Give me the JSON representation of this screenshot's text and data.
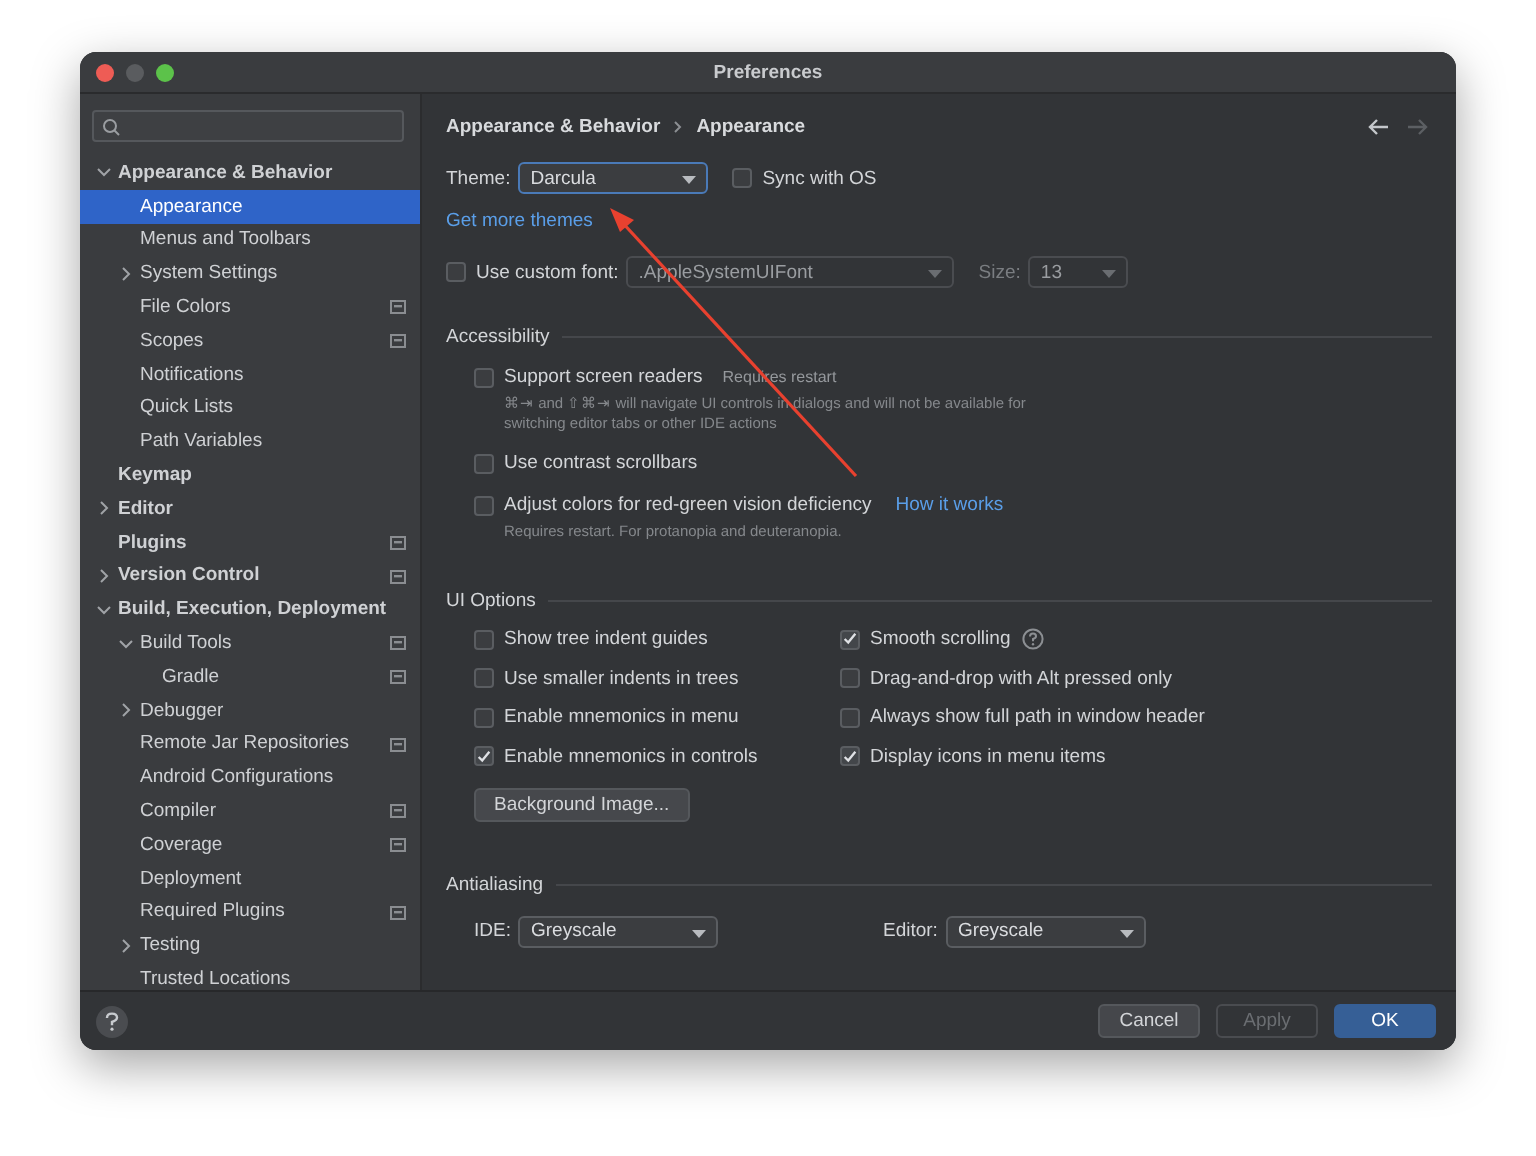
{
  "window": {
    "title": "Preferences"
  },
  "sidebar": {
    "items": [
      {
        "label": "Appearance & Behavior",
        "expanded": true,
        "selected": false,
        "children": [
          {
            "label": "Appearance",
            "selected": true
          },
          {
            "label": "Menus and Toolbars",
            "selected": false
          },
          {
            "label": "System Settings",
            "expanded": false,
            "selected": false
          },
          {
            "label": "File Colors",
            "selected": false,
            "project": true
          },
          {
            "label": "Scopes",
            "selected": false,
            "project": true
          },
          {
            "label": "Notifications",
            "selected": false
          },
          {
            "label": "Quick Lists",
            "selected": false
          },
          {
            "label": "Path Variables",
            "selected": false
          }
        ]
      },
      {
        "label": "Keymap",
        "selected": false
      },
      {
        "label": "Editor",
        "expanded": false,
        "selected": false
      },
      {
        "label": "Plugins",
        "selected": false,
        "project": true
      },
      {
        "label": "Version Control",
        "expanded": false,
        "selected": false,
        "project": true
      },
      {
        "label": "Build, Execution, Deployment",
        "expanded": true,
        "selected": false,
        "children": [
          {
            "label": "Build Tools",
            "expanded": true,
            "selected": false,
            "project": true,
            "children": [
              {
                "label": "Gradle",
                "selected": false,
                "project": true
              }
            ]
          },
          {
            "label": "Debugger",
            "expanded": false,
            "selected": false
          },
          {
            "label": "Remote Jar Repositories",
            "selected": false,
            "project": true
          },
          {
            "label": "Android Configurations",
            "selected": false
          },
          {
            "label": "Compiler",
            "selected": false,
            "project": true
          },
          {
            "label": "Coverage",
            "selected": false,
            "project": true
          },
          {
            "label": "Deployment",
            "selected": false
          },
          {
            "label": "Required Plugins",
            "selected": false,
            "project": true
          },
          {
            "label": "Testing",
            "expanded": false,
            "selected": false
          },
          {
            "label": "Trusted Locations",
            "selected": false
          }
        ]
      }
    ]
  },
  "breadcrumb": [
    "Appearance & Behavior",
    "Appearance"
  ],
  "theme": {
    "label": "Theme:",
    "value": "Darcula",
    "sync": {
      "label": "Sync with OS",
      "checked": false
    }
  },
  "get_more_themes": "Get more themes",
  "custom_font": {
    "label": "Use custom font:",
    "checked": false,
    "font": ".AppleSystemUIFont",
    "size_label": "Size:",
    "size": "13",
    "disabled": true
  },
  "accessibility": {
    "title": "Accessibility",
    "options": [
      {
        "label": "Support screen readers",
        "checked": false,
        "note": "Requires restart",
        "hint": "⌘⇥ and ⇧⌘⇥ will navigate UI controls in dialogs and will not be available for switching editor tabs or other IDE actions"
      },
      {
        "label": "Use contrast scrollbars",
        "checked": false
      },
      {
        "label": "Adjust colors for red-green vision deficiency",
        "checked": false,
        "link": "How it works",
        "hint": "Requires restart. For protanopia and deuteranopia."
      }
    ]
  },
  "ui_options": {
    "title": "UI Options",
    "options": [
      {
        "label": "Show tree indent guides",
        "checked": false
      },
      {
        "label": "Smooth scrolling",
        "checked": true,
        "help": true
      },
      {
        "label": "Use smaller indents in trees",
        "checked": false
      },
      {
        "label": "Drag-and-drop with Alt pressed only",
        "checked": false
      },
      {
        "label": "Enable mnemonics in menu",
        "checked": false
      },
      {
        "label": "Always show full path in window header",
        "checked": false
      },
      {
        "label": "Enable mnemonics in controls",
        "checked": true
      },
      {
        "label": "Display icons in menu items",
        "checked": true
      }
    ],
    "background_button": "Background Image..."
  },
  "antialiasing": {
    "title": "Antialiasing",
    "ide_label": "IDE:",
    "ide": "Greyscale",
    "editor_label": "Editor:",
    "editor": "Greyscale"
  },
  "buttons": [
    {
      "label": "Cancel",
      "kind": "normal"
    },
    {
      "label": "Apply",
      "kind": "disabled"
    },
    {
      "label": "OK",
      "kind": "default"
    }
  ]
}
